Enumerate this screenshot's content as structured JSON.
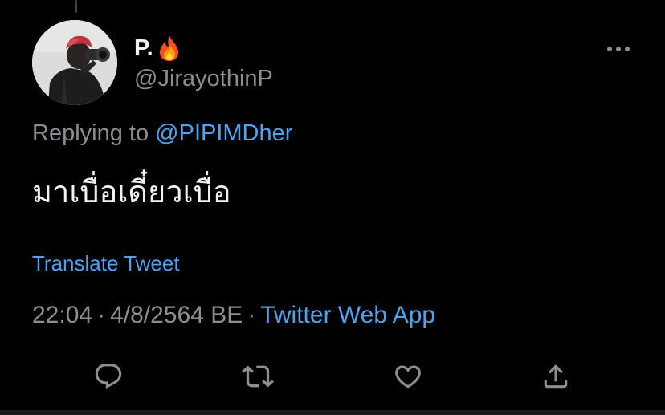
{
  "tweet": {
    "author": {
      "display_name": "P.",
      "emoji": "fire-emoji",
      "handle": "@JirayothinP"
    },
    "replying_prefix": "Replying to",
    "replying_to": "@PIPIMDher",
    "text": "มาเบื่อเดี๋ยวเบื่อ",
    "translate_label": "Translate Tweet",
    "time": "22:04",
    "date": "4/8/2564 BE",
    "separator": "·",
    "source": "Twitter Web App"
  },
  "actions": [
    {
      "name": "reply",
      "icon": "reply-icon"
    },
    {
      "name": "retweet",
      "icon": "retweet-icon"
    },
    {
      "name": "like",
      "icon": "heart-icon"
    },
    {
      "name": "share",
      "icon": "share-icon"
    }
  ],
  "colors": {
    "background": "#000000",
    "text_primary": "#f2f2f2",
    "text_secondary": "#8b8f94",
    "link": "#4da3ef"
  }
}
